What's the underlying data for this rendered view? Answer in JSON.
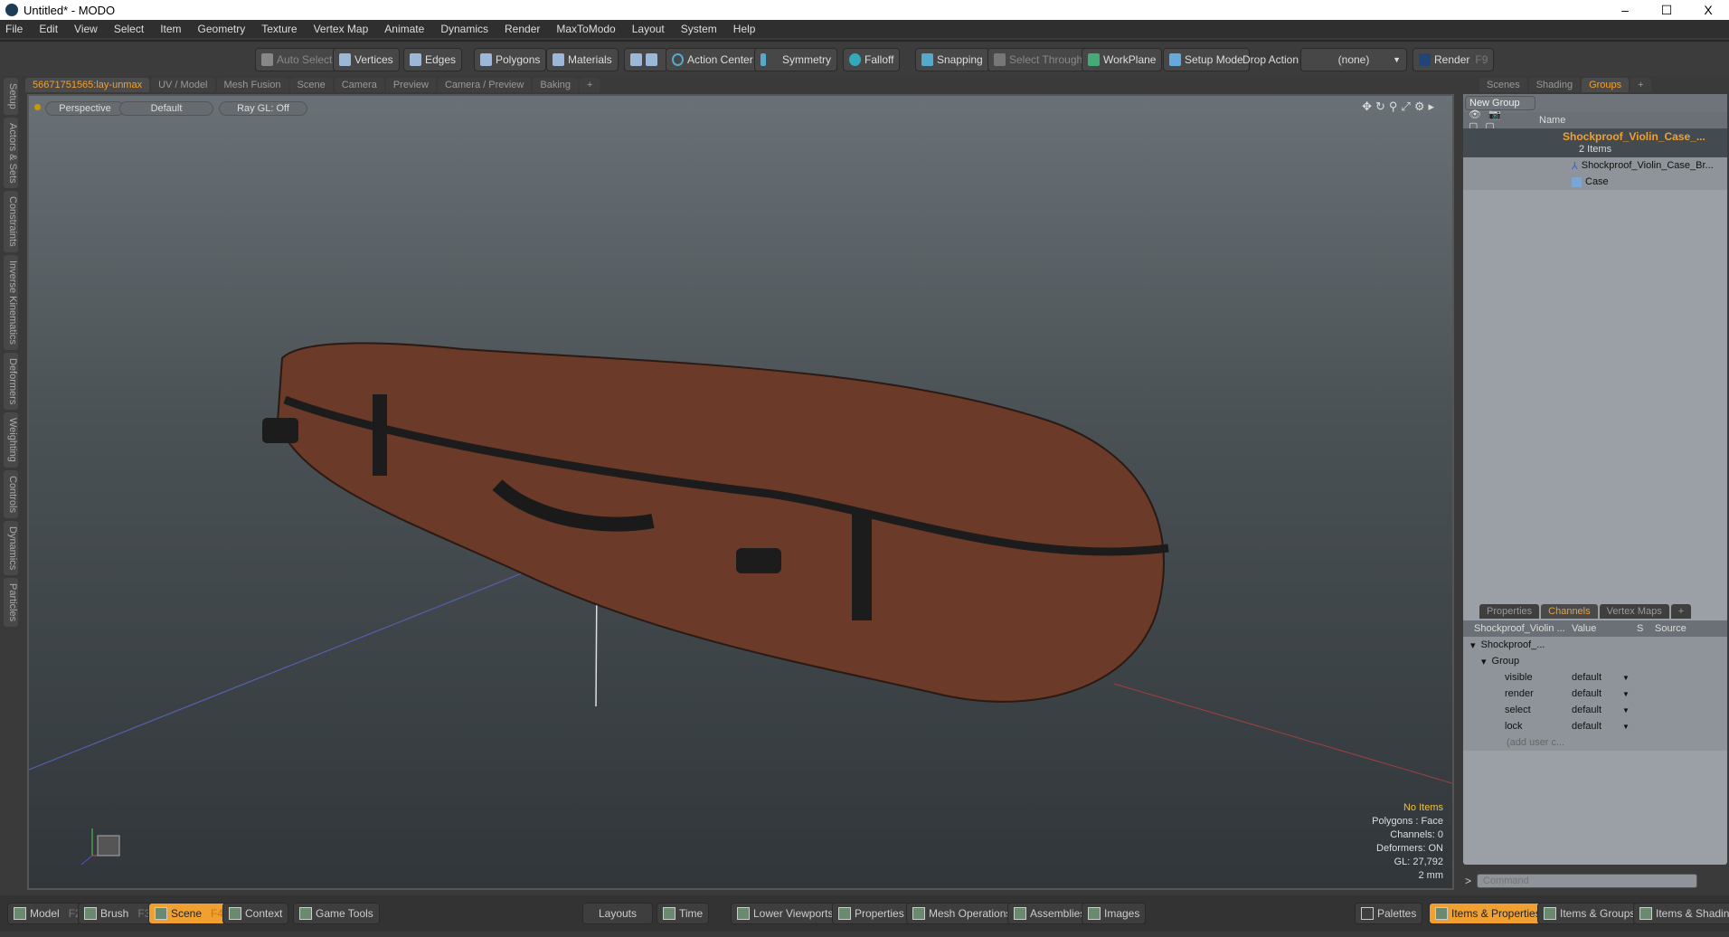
{
  "window": {
    "title": "Untitled* - MODO",
    "minimize": "–",
    "maximize": "☐",
    "close": "X"
  },
  "menu": [
    "File",
    "Edit",
    "View",
    "Select",
    "Item",
    "Geometry",
    "Texture",
    "Vertex Map",
    "Animate",
    "Dynamics",
    "Render",
    "MaxToModo",
    "Layout",
    "System",
    "Help"
  ],
  "toolbar": {
    "auto_select": "Auto Select",
    "vertices": "Vertices",
    "edges": "Edges",
    "polygons": "Polygons",
    "materials": "Materials",
    "action_center": "Action Center",
    "symmetry": "Symmetry",
    "falloff": "Falloff",
    "snapping": "Snapping",
    "select_through": "Select Through",
    "workplane": "WorkPlane",
    "setup_mode": "Setup Mode",
    "drop_action": "Drop Action",
    "drop_value": "(none)",
    "render": "Render",
    "render_key": "F9"
  },
  "tabs": [
    "56671751565:lay-unmax",
    "UV / Model",
    "Mesh Fusion",
    "Scene",
    "Camera",
    "Preview",
    "Camera / Preview",
    "Baking",
    "+"
  ],
  "left_tabs": [
    "Setup",
    "Actors & Sets",
    "Constraints",
    "Inverse Kinematics",
    "Deformers",
    "Weighting",
    "Controls",
    "Dynamics",
    "Particles"
  ],
  "viewport": {
    "view": "Perspective",
    "shading": "Default",
    "raygl": "Ray GL: Off",
    "info": {
      "selection": "No Items",
      "polygons": "Polygons : Face",
      "channels": "Channels: 0",
      "deformers": "Deformers: ON",
      "gl": "GL: 27,792",
      "unit": "2 mm"
    }
  },
  "right_tabs": [
    "Scenes",
    "Shading",
    "Groups",
    "+"
  ],
  "groups": {
    "new_group": "New Group",
    "name_header": "Name",
    "group_name": "Shockproof_Violin_Case_...",
    "group_count": "2 Items",
    "children": [
      "Shockproof_Violin_Case_Br...",
      "Case"
    ]
  },
  "props_tabs": [
    "Properties",
    "Channels",
    "Vertex Maps",
    "+"
  ],
  "channels": {
    "headers": [
      "Shockproof_Violin ...",
      "Value",
      "S",
      "Source"
    ],
    "item": "Shockproof_...",
    "group": "Group",
    "rows": [
      {
        "name": "visible",
        "value": "default"
      },
      {
        "name": "render",
        "value": "default"
      },
      {
        "name": "select",
        "value": "default"
      },
      {
        "name": "lock",
        "value": "default"
      }
    ],
    "add": "(add user c..."
  },
  "command_placeholder": "Command",
  "bottom": {
    "model": "Model",
    "f2": "F2",
    "brush": "Brush",
    "f3": "F3",
    "scene": "Scene",
    "f4": "F4",
    "context": "Context",
    "game_tools": "Game Tools",
    "layouts": "Layouts",
    "time": "Time",
    "lower_viewports": "Lower Viewports",
    "properties": "Properties",
    "mesh_operations": "Mesh Operations",
    "assemblies": "Assemblies",
    "images": "Images",
    "palettes": "Palettes",
    "items_properties": "Items & Properties",
    "items_groups": "Items & Groups",
    "items_shading": "Items & Shading"
  },
  "colors": {
    "accent": "#f0a030",
    "case": "#6b3a28"
  }
}
